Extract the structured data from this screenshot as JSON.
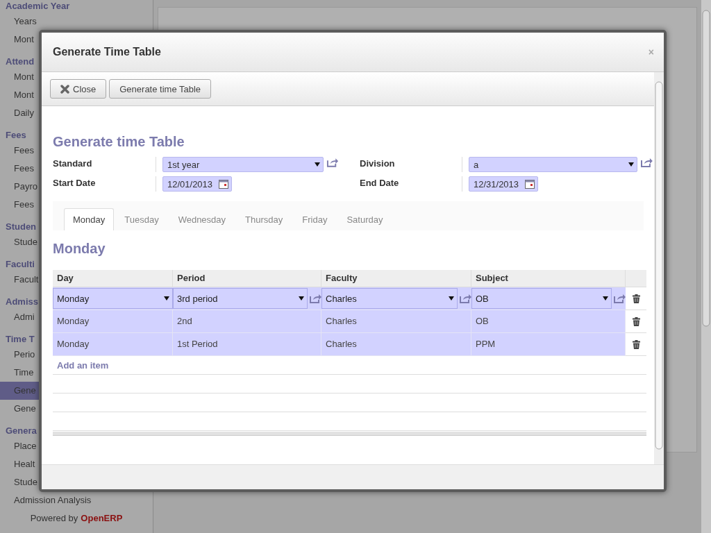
{
  "sidebar": {
    "sections": [
      {
        "title": "Academic Year",
        "items": [
          {
            "label": "Years",
            "selected": false
          },
          {
            "label": "Mont",
            "selected": false
          }
        ]
      },
      {
        "title": "Attend",
        "items": [
          {
            "label": "Mont",
            "selected": false
          },
          {
            "label": "Mont",
            "selected": false
          },
          {
            "label": "Daily",
            "selected": false
          }
        ]
      },
      {
        "title": "Fees",
        "items": [
          {
            "label": "Fees",
            "selected": false
          },
          {
            "label": "Fees",
            "selected": false
          },
          {
            "label": "Payro",
            "selected": false
          },
          {
            "label": "Fees",
            "selected": false
          }
        ]
      },
      {
        "title": "Studen",
        "items": [
          {
            "label": "Stude",
            "selected": false
          }
        ]
      },
      {
        "title": "Faculti",
        "items": [
          {
            "label": "Facult",
            "selected": false
          }
        ]
      },
      {
        "title": "Admiss",
        "items": [
          {
            "label": "Admi",
            "selected": false
          }
        ]
      },
      {
        "title": "Time T",
        "items": [
          {
            "label": "Perio",
            "selected": false
          },
          {
            "label": "Time",
            "selected": false
          },
          {
            "label": "Gene",
            "selected": true
          },
          {
            "label": "Gene",
            "selected": false
          }
        ]
      },
      {
        "title": "Genera",
        "items": [
          {
            "label": "Place",
            "selected": false
          },
          {
            "label": "Healt",
            "selected": false
          },
          {
            "label": "Stude",
            "selected": false
          },
          {
            "label": "Admission Analysis",
            "selected": false
          }
        ]
      }
    ],
    "footer": {
      "prefix": "Powered by",
      "brand": "OpenERP"
    }
  },
  "dialog": {
    "title": "Generate Time Table",
    "close": "×",
    "buttons": [
      {
        "label": "Close",
        "kind": "close"
      },
      {
        "label": "Generate time Table",
        "kind": "plain"
      }
    ],
    "form": {
      "title": "Generate time Table",
      "fields": [
        {
          "label": "Standard",
          "value": "1st year",
          "kind": "select"
        },
        {
          "label": "Division",
          "value": "a",
          "kind": "select"
        },
        {
          "label": "Start Date",
          "value": "12/01/2013",
          "kind": "date"
        },
        {
          "label": "End Date",
          "value": "12/31/2013",
          "kind": "date"
        }
      ],
      "tabs": [
        {
          "label": "Monday",
          "selected": true
        },
        {
          "label": "Tuesday",
          "selected": false
        },
        {
          "label": "Wednesday",
          "selected": false
        },
        {
          "label": "Thursday",
          "selected": false
        },
        {
          "label": "Friday",
          "selected": false
        },
        {
          "label": "Saturday",
          "selected": false
        }
      ],
      "section_title": "Monday",
      "table": {
        "columns": [
          "Day",
          "Period",
          "Faculty",
          "Subject"
        ],
        "rows": [
          {
            "editing": true,
            "cells": [
              "Monday",
              "3rd period",
              "Charles",
              "OB"
            ]
          },
          {
            "editing": false,
            "cells": [
              "Monday",
              "2nd",
              "Charles",
              "OB"
            ]
          },
          {
            "editing": false,
            "cells": [
              "Monday",
              "1st Period",
              "Charles",
              "PPM"
            ]
          }
        ],
        "add_item": "Add an item"
      }
    }
  }
}
